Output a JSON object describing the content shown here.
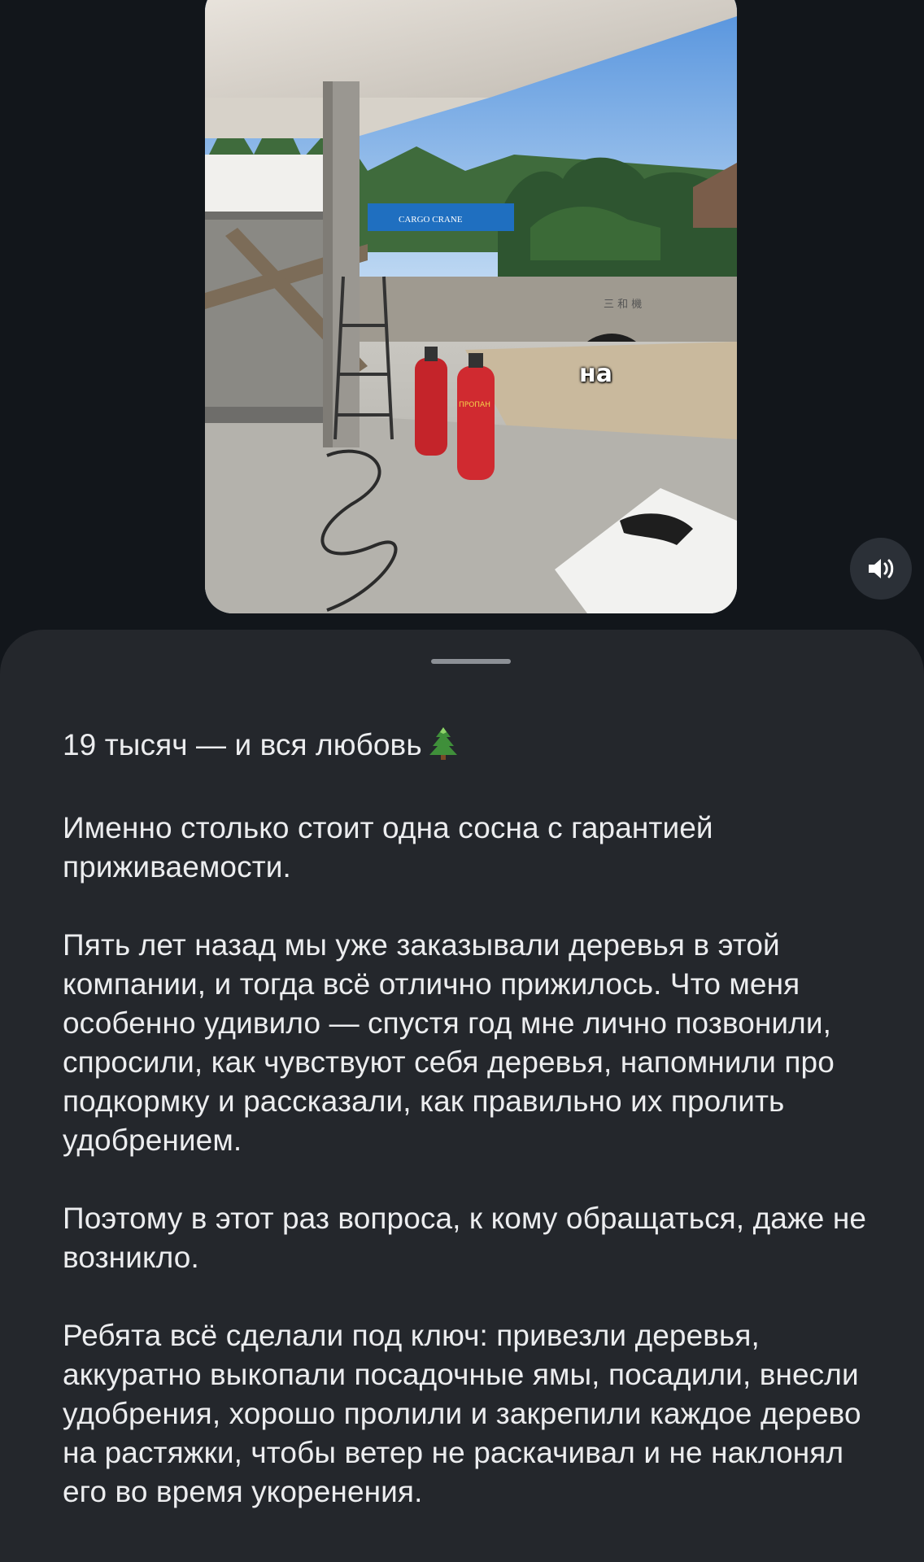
{
  "video": {
    "overlay_caption": "на",
    "sign_text": "CARGO CRANE",
    "truck_text": "三 和 機",
    "cylinder_label": "ПРОПАН"
  },
  "controls": {
    "sound_icon": "speaker-volume-icon"
  },
  "post": {
    "title": "19 тысяч — и вся любовь",
    "title_icon": "christmas-tree-icon",
    "paragraphs": [
      "Именно столько стоит одна сосна с гарантией приживаемости.",
      "Пять лет назад мы уже заказывали деревья в этой компании, и тогда всё отлично прижилось. Что меня особенно удивило — спустя год мне лично позвонили, спросили, как чувствуют себя деревья, напомнили про подкормку и рассказали, как правильно их пролить удобрением.",
      "Поэтому в этот раз вопроса, к кому обращаться, даже не возникло.",
      "Ребята всё сделали под ключ: привезли деревья, аккуратно выкопали посадочные ямы, посадили, внесли удобрения, хорошо пролили и закрепили каждое дерево на растяжки, чтобы ветер не раскачивал и не наклонял его во время укоренения."
    ]
  },
  "colors": {
    "background": "#12161b",
    "sheet": "#24272c",
    "text": "#ecedef",
    "handle": "#8c9096"
  }
}
